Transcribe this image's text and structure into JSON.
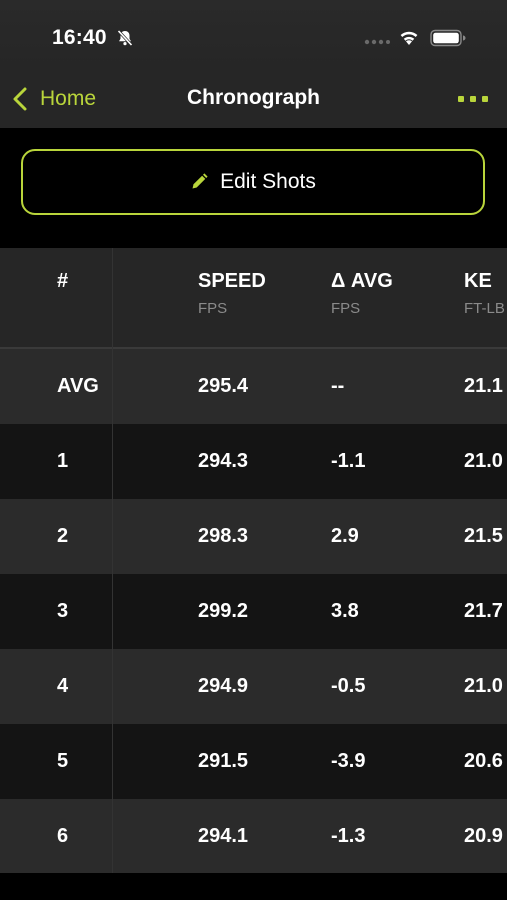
{
  "status_bar": {
    "time": "16:40",
    "icons": [
      "bell-slash-icon",
      "cellular-dots-icon",
      "wifi-icon",
      "battery-icon"
    ]
  },
  "nav": {
    "back_label": "Home",
    "title": "Chronograph",
    "more_icon": "ellipsis-icon"
  },
  "edit_button": {
    "label": "Edit Shots",
    "icon": "pencil-icon"
  },
  "colors": {
    "accent": "#b9d53b",
    "background": "#000000",
    "row_light": "#2b2b2b",
    "row_dark": "#141414"
  },
  "table": {
    "headers": [
      {
        "label": "#",
        "unit": ""
      },
      {
        "label": "SPEED",
        "unit": "FPS"
      },
      {
        "label": "Δ AVG",
        "unit": "FPS"
      },
      {
        "label": "KE",
        "unit": "FT-LB"
      }
    ],
    "rows": [
      [
        "AVG",
        "295.4",
        "--",
        "21.1"
      ],
      [
        "1",
        "294.3",
        "-1.1",
        "21.0"
      ],
      [
        "2",
        "298.3",
        "2.9",
        "21.5"
      ],
      [
        "3",
        "299.2",
        "3.8",
        "21.7"
      ],
      [
        "4",
        "294.9",
        "-0.5",
        "21.0"
      ],
      [
        "5",
        "291.5",
        "-3.9",
        "20.6"
      ],
      [
        "6",
        "294.1",
        "-1.3",
        "20.9"
      ]
    ]
  }
}
